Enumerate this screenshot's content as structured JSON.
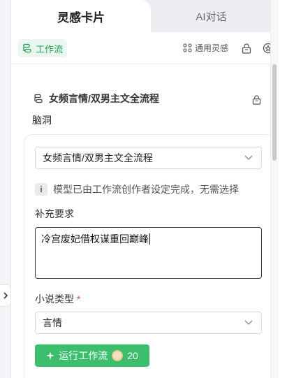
{
  "tabs": {
    "active": "灵感卡片",
    "inactive": "AI对话"
  },
  "toolbar": {
    "workflow_label": "工作流",
    "general_inspire_label": "通用灵感"
  },
  "workflow": {
    "title": "女频言情/双男主文全流程",
    "section_label": "脑洞"
  },
  "form": {
    "workflow_select_value": "女频言情/双男主文全流程",
    "info_text": "模型已由工作流创作者设定完成，无需选择",
    "info_icon_text": "i",
    "supplement_label": "补充要求",
    "supplement_value": "冷宫废妃借权谋重回巅峰",
    "novel_type_label": "小说类型",
    "required_mark": "*",
    "novel_type_value": "言情",
    "run_button_label": "运行工作流",
    "run_cost": "20"
  },
  "colors": {
    "accent_green": "#3bbf6c",
    "workflow_chip_bg": "#eaf7ef",
    "required_red": "#e5484d"
  },
  "icons": {
    "collapse": "chevron-right-icon",
    "workflow": "workflow-icon",
    "general_inspire": "scatter-icon",
    "lock": "lock-icon",
    "settings": "gear-icon",
    "sparkle": "sparkle-icon",
    "coin": "coin-icon"
  }
}
